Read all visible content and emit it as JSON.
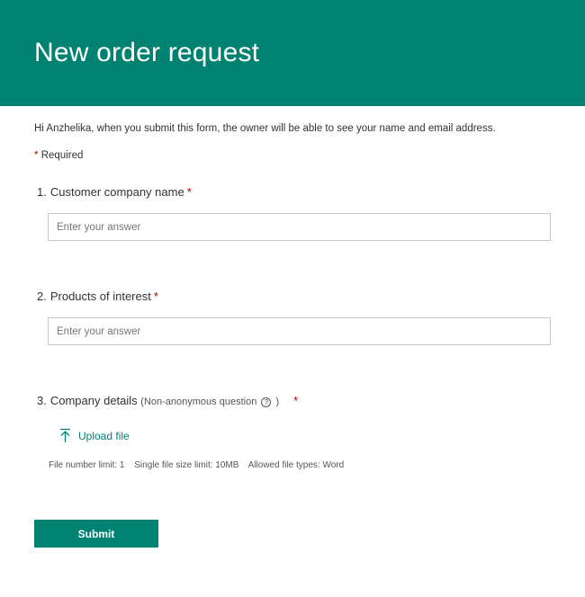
{
  "form": {
    "title": "New order request",
    "notice": "Hi Anzhelika, when you submit this form, the owner will be able to see your name and email address.",
    "required_marker": "*",
    "required_label": "Required"
  },
  "questions": [
    {
      "number": "1.",
      "title": "Customer company name",
      "required_marker": "*",
      "placeholder": "Enter your answer",
      "value": ""
    },
    {
      "number": "2.",
      "title": "Products of interest",
      "required_marker": "*",
      "placeholder": "Enter your answer",
      "value": ""
    },
    {
      "number": "3.",
      "title": "Company details",
      "note_open": "(Non-anonymous question",
      "help_glyph": "?",
      "note_close": ")",
      "required_marker": "*",
      "upload_label": "Upload file",
      "upload_icon": "upload-arrow-icon",
      "limits": {
        "file_number": "File number limit: 1",
        "file_size": "Single file size limit: 10MB",
        "file_types": "Allowed file types: Word"
      }
    }
  ],
  "submit_label": "Submit",
  "colors": {
    "accent": "#008272",
    "required": "#a80000",
    "text": "#333333",
    "input_border": "#c8c8c8"
  }
}
